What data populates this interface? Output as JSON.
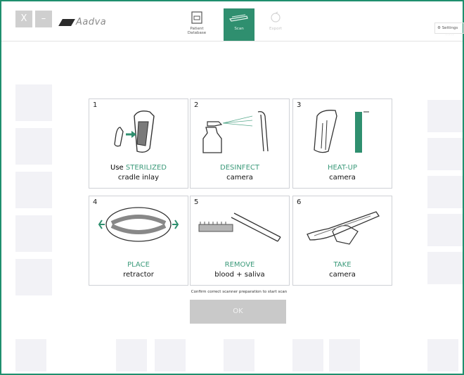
{
  "window": {
    "close_label": "X",
    "minimize_label": "–"
  },
  "brand": {
    "name": "Aadva"
  },
  "nav": {
    "patient_database": "Patient\nDatabase",
    "scan": "Scan",
    "export": "Export"
  },
  "settings": {
    "label": "Settings"
  },
  "steps": [
    {
      "number": "1",
      "prefix": "Use ",
      "highlight": "STERILIZED",
      "line2": "cradle inlay",
      "icon": "cradle-inlay-icon"
    },
    {
      "number": "2",
      "prefix": "",
      "highlight": "DESINFECT",
      "line2": "camera",
      "icon": "spray-bottle-icon"
    },
    {
      "number": "3",
      "prefix": "",
      "highlight": "HEAT-UP",
      "line2": "camera",
      "icon": "heat-up-icon"
    },
    {
      "number": "4",
      "prefix": "",
      "highlight": "PLACE",
      "line2": "retractor",
      "icon": "retractor-icon"
    },
    {
      "number": "5",
      "prefix": "",
      "highlight": "REMOVE",
      "line2": "blood + saliva",
      "icon": "toothbrush-icon"
    },
    {
      "number": "6",
      "prefix": "",
      "highlight": "TAKE",
      "line2": "camera",
      "icon": "intraoral-camera-icon"
    }
  ],
  "confirm_text": "Confirm correct scanner preparation to start scan",
  "ok_label": "OK",
  "colors": {
    "accent": "#3b9a7a",
    "frame": "#1f8f6e",
    "nav_active": "#2f8f6f",
    "button_disabled": "#c9c9c9"
  }
}
